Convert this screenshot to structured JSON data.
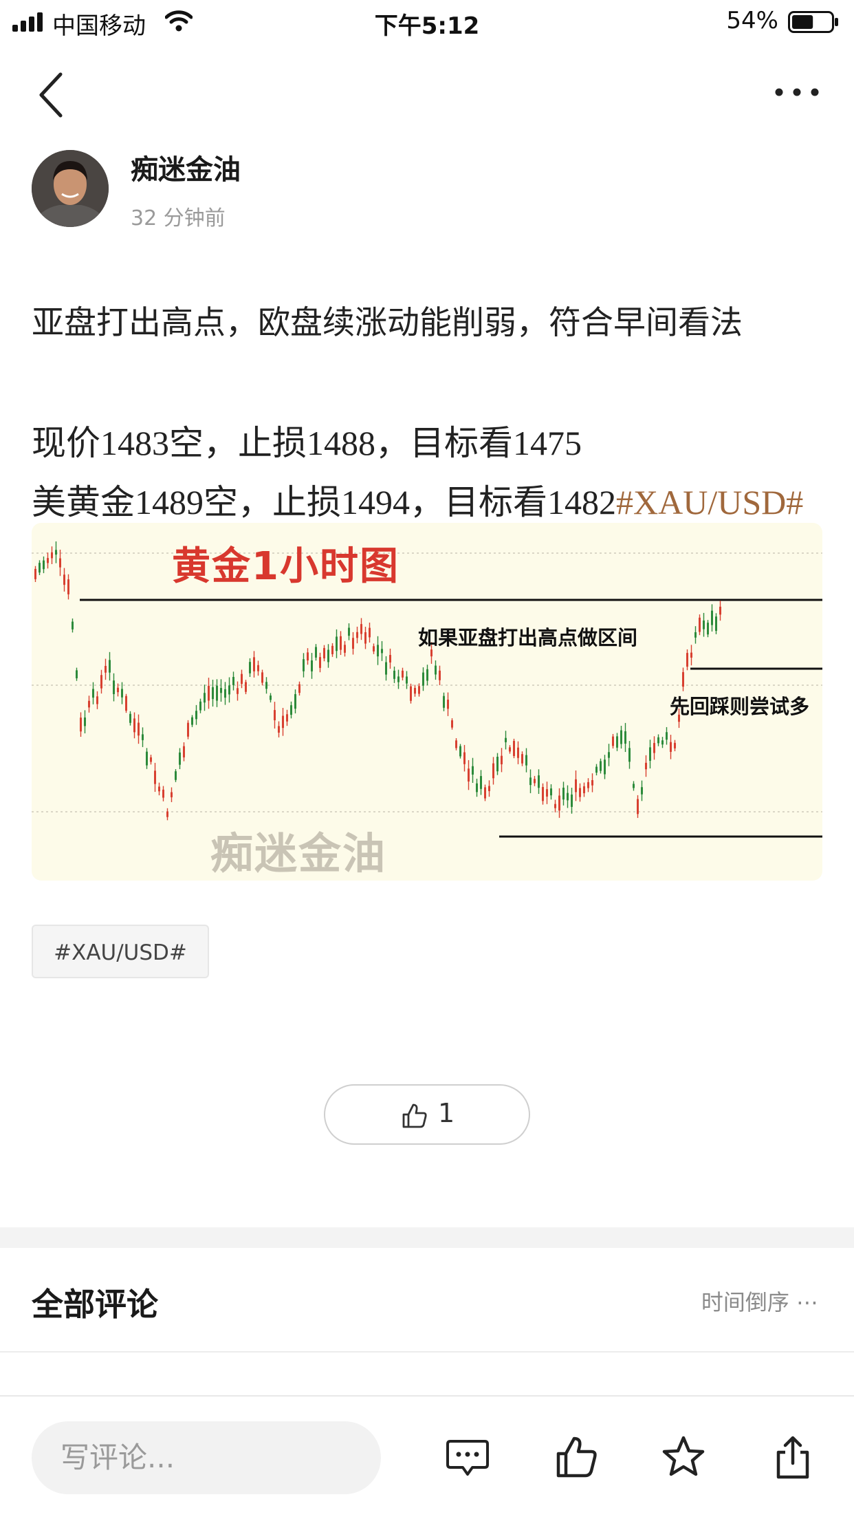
{
  "status_bar": {
    "carrier": "中国移动",
    "time": "下午5:12",
    "battery_percent": "54%",
    "battery_level": 0.54
  },
  "nav": {
    "back_icon": "chevron-left-icon",
    "more_icon": "more-dots-icon"
  },
  "author": {
    "name": "痴迷金油",
    "time_ago": "32 分钟前"
  },
  "post": {
    "line1": "亚盘打出高点，欧盘续涨动能削弱，符合早间看法",
    "line2": "现价1483空，止损1488，目标看1475",
    "line3": "美黄金1489空，止损1494，目标看1482",
    "line3_tag": "#XAU/USD#",
    "image": {
      "title": "黄金1小时图",
      "note_top": "如果亚盘打出高点做区间",
      "note_right": "先回踩则尝试多",
      "watermark": "痴迷金油"
    }
  },
  "tag_chip": "#XAU/USD#",
  "like": {
    "count": "1"
  },
  "comments": {
    "title": "全部评论",
    "sort_label": "时间倒序 ⋯"
  },
  "bottom_bar": {
    "input_placeholder": "写评论...",
    "icons": [
      "comment-icon",
      "thumbs-up-icon",
      "star-icon",
      "share-icon"
    ]
  },
  "colors": {
    "tag_brown": "#a0683c",
    "chart_title_red": "#d8382e",
    "candle_red": "#d84030",
    "candle_green": "#2c8a3a"
  }
}
